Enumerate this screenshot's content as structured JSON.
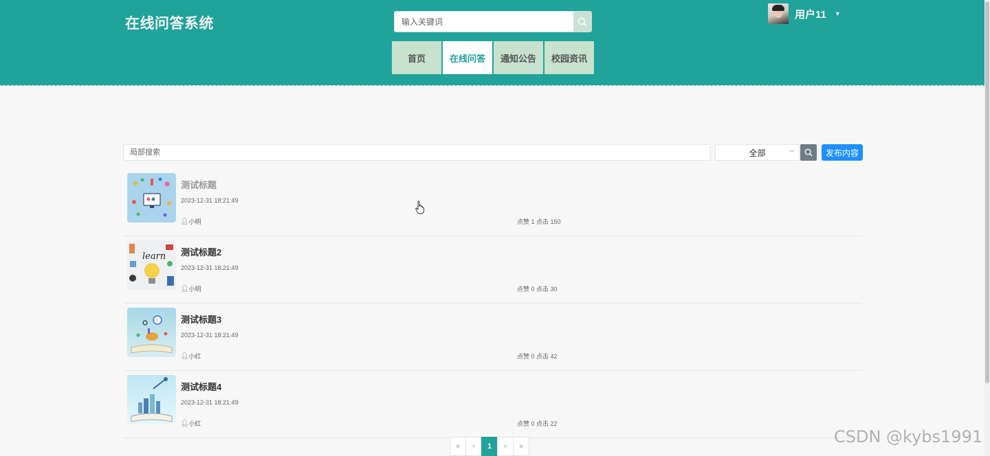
{
  "header": {
    "site_title": "在线问答系统",
    "search_placeholder": "输入关键词",
    "nav": [
      {
        "label": "首页",
        "active": false
      },
      {
        "label": "在线问答",
        "active": true
      },
      {
        "label": "通知公告",
        "active": false
      },
      {
        "label": "校园资讯",
        "active": false
      }
    ],
    "user": {
      "name": "用户11",
      "avatar": "user-avatar-photo"
    }
  },
  "toolbar": {
    "search_placeholder": "局部搜索",
    "filter_selected": "全部",
    "publish_label": "发布内容"
  },
  "items": [
    {
      "title": "测试标题",
      "time": "2023-12-31 18:21:49",
      "author": "小明",
      "stats": "点赞 1 点击 150"
    },
    {
      "title": "测试标题2",
      "time": "2023-12-31 18:21:49",
      "author": "小明",
      "stats": "点赞 0 点击 30"
    },
    {
      "title": "测试标题3",
      "time": "2023-12-31 18:21:49",
      "author": "小红",
      "stats": "点赞 0 点击 42"
    },
    {
      "title": "测试标题4",
      "time": "2023-12-31 18:21:49",
      "author": "小红",
      "stats": "点赞 0 点击 22"
    }
  ],
  "pagination": {
    "first": "«",
    "prev": "‹",
    "current": "1",
    "next": "›",
    "last": "»"
  },
  "watermark": "CSDN @kybs1991",
  "colors": {
    "primary": "#1fa39a",
    "nav_bg": "#c7e2cf",
    "publish": "#1e90ff"
  }
}
